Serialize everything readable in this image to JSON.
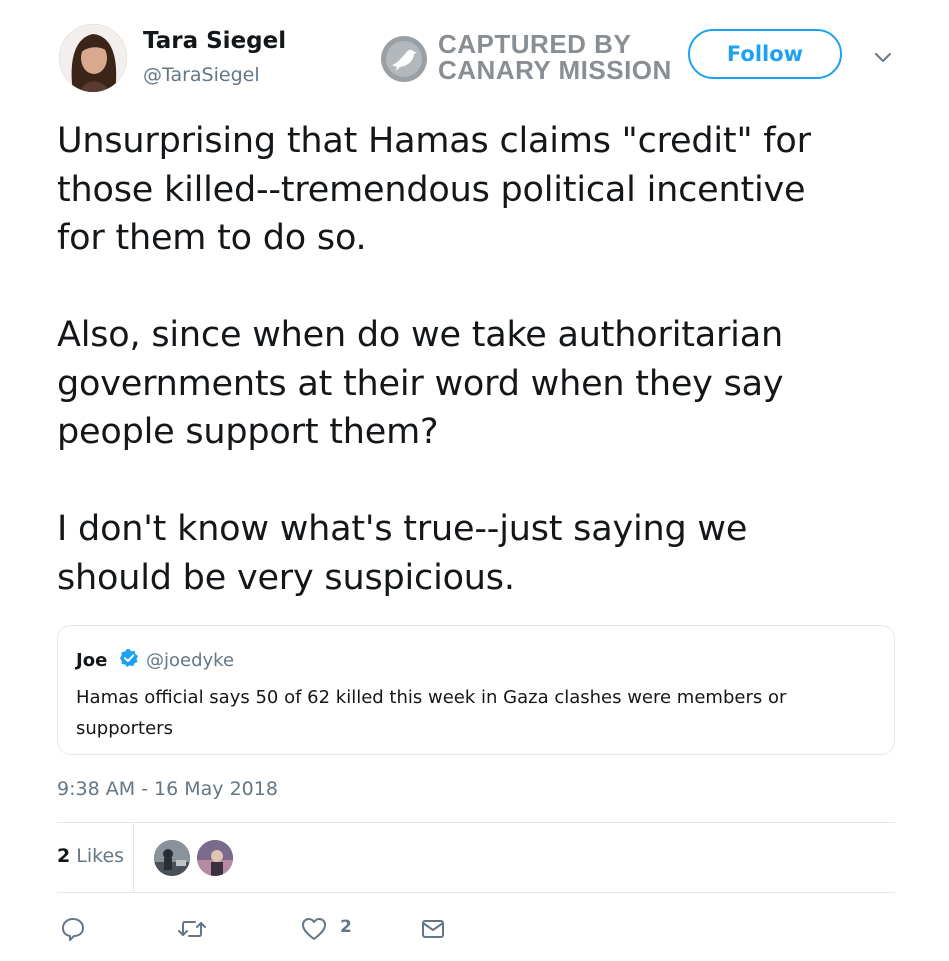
{
  "author": {
    "name": "Tara Siegel",
    "handle": "@TaraSiegel"
  },
  "watermark": {
    "line1": "CAPTURED BY",
    "line2": "CANARY MISSION"
  },
  "follow_label": "Follow",
  "tweet_text": "Unsurprising that Hamas claims \"credit\" for\nthose killed--tremendous political incentive\nfor them to do so.\n\nAlso, since when do we take authoritarian\ngovernments at their word when they say\npeople support them?\n\nI don't know what's true--just saying we\nshould be very suspicious.",
  "quoted_tweet": {
    "name": "Joe",
    "handle": "@joedyke",
    "text": "Hamas official says 50 of 62 killed this week in Gaza clashes were members or supporters"
  },
  "timestamp": "9:38 AM - 16 May 2018",
  "likes": {
    "count": "2",
    "label": "Likes"
  },
  "actions": {
    "like_count": "2"
  },
  "icons": [
    "caret-down-icon",
    "verified-badge-icon",
    "reply-icon",
    "retweet-icon",
    "heart-icon",
    "envelope-icon",
    "canary-logo-icon"
  ],
  "colors": {
    "accent": "#1da1f2",
    "secondary_text": "#657786",
    "primary_text": "#14171a",
    "border": "#e1e8ed"
  }
}
